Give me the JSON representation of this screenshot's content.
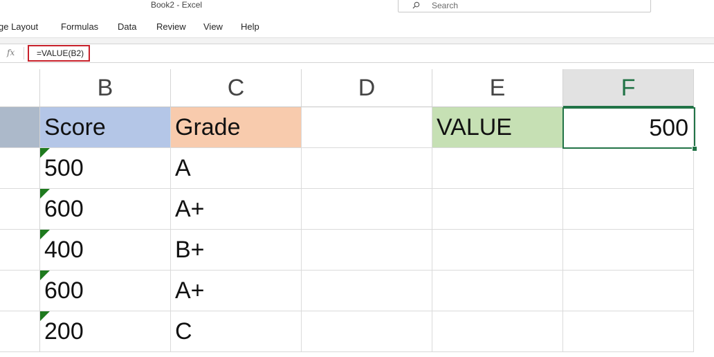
{
  "window": {
    "title": "Book2  -  Excel"
  },
  "search": {
    "placeholder": "Search"
  },
  "menu": [
    "ge Layout",
    "Formulas",
    "Data",
    "Review",
    "View",
    "Help"
  ],
  "formula_bar": {
    "fx_label": "fx",
    "formula": "=VALUE(B2)"
  },
  "columns": [
    "B",
    "C",
    "D",
    "E",
    "F"
  ],
  "selected_column": "F",
  "headers": {
    "score": "Score",
    "grade": "Grade",
    "value_label": "VALUE",
    "value_result": "500"
  },
  "rows": [
    {
      "score": "500",
      "grade": "A"
    },
    {
      "score": "600",
      "grade": "A+"
    },
    {
      "score": "400",
      "grade": "B+"
    },
    {
      "score": "600",
      "grade": "A+"
    },
    {
      "score": "200",
      "grade": "C"
    }
  ],
  "colors": {
    "score_header_bg": "#b4c6e7",
    "grade_header_bg": "#f8cbad",
    "value_header_bg": "#c6e0b4",
    "row_header_fragment_bg": "#acb9ca",
    "accent": "#217346",
    "formula_highlight": "#c7202a"
  }
}
